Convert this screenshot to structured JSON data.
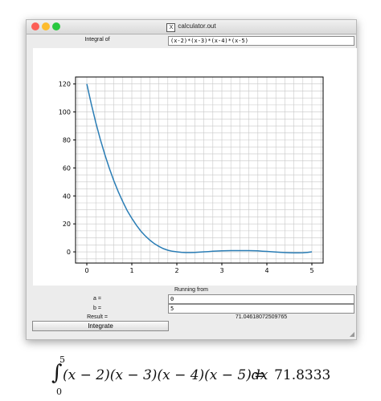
{
  "window": {
    "title": "calculator.out",
    "title_icon": "x11-icon"
  },
  "integral": {
    "label": "Integral of",
    "value": "(x-2)*(x-3)*(x-4)*(x-5)"
  },
  "running_from_label": "Running from",
  "a": {
    "label": "a =",
    "value": "0"
  },
  "b": {
    "label": "b =",
    "value": "5"
  },
  "result": {
    "label": "Result =",
    "value": "71.04618072509765"
  },
  "integrate_button": "Integrate",
  "formula": {
    "upper": "5",
    "lower": "0",
    "expression": "(x − 2)(x − 3)(x − 4)(x − 5)dx",
    "equals": "=",
    "value": "71.8333"
  },
  "chart_data": {
    "type": "line",
    "title": "",
    "xlabel": "",
    "ylabel": "",
    "xlim": [
      -0.25,
      5.25
    ],
    "ylim": [
      -8,
      125
    ],
    "xticks": [
      0,
      1,
      2,
      3,
      4,
      5
    ],
    "yticks": [
      0,
      20,
      40,
      60,
      80,
      100,
      120
    ],
    "grid": true,
    "series_color": "#2a7db5",
    "series": [
      {
        "x": [
          0,
          0.1,
          0.2,
          0.3,
          0.4,
          0.5,
          0.6,
          0.7,
          0.8,
          0.9,
          1.0,
          1.1,
          1.2,
          1.3,
          1.4,
          1.5,
          1.6,
          1.7,
          1.8,
          1.9,
          2.0,
          2.1,
          2.2,
          2.3,
          2.4,
          2.5,
          2.6,
          2.7,
          2.8,
          2.9,
          3.0,
          3.1,
          3.2,
          3.3,
          3.4,
          3.5,
          3.6,
          3.7,
          3.8,
          3.9,
          4.0,
          4.1,
          4.2,
          4.3,
          4.4,
          4.5,
          4.6,
          4.7,
          4.8,
          4.9,
          5.0
        ],
        "y": [
          120,
          105.6,
          92.4,
          80.4,
          69.6,
          59.8,
          50.9,
          42.9,
          35.8,
          29.3,
          24.0,
          19.1,
          14.9,
          11.4,
          8.4,
          5.9,
          3.9,
          2.3,
          1.2,
          0.4,
          0.0,
          -0.3,
          -0.5,
          -0.5,
          -0.4,
          -0.2,
          0.0,
          0.2,
          0.4,
          0.6,
          0.7,
          0.8,
          0.9,
          0.9,
          0.9,
          0.9,
          0.9,
          0.8,
          0.7,
          0.5,
          0.3,
          0.1,
          -0.1,
          -0.3,
          -0.5,
          -0.6,
          -0.7,
          -0.7,
          -0.6,
          -0.4,
          0.0
        ]
      }
    ]
  }
}
